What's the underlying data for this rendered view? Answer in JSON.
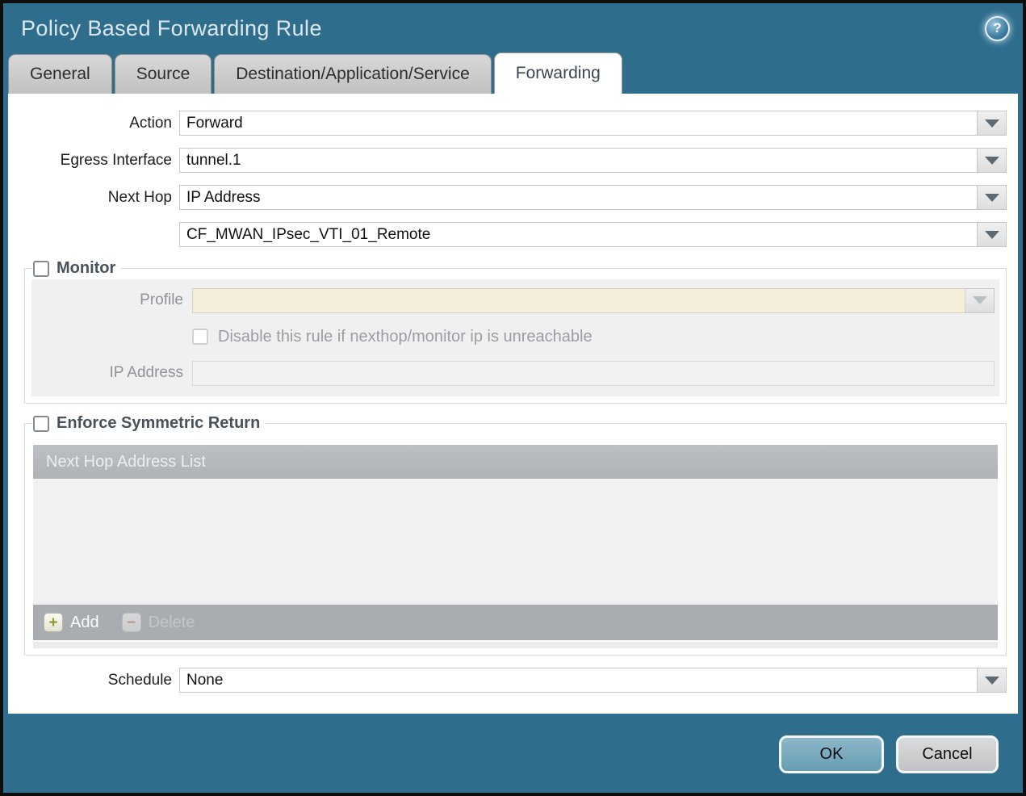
{
  "window": {
    "title": "Policy Based Forwarding Rule"
  },
  "icons": {
    "help": "?",
    "add": "+",
    "delete": "−"
  },
  "tabs": [
    {
      "label": "General",
      "active": false
    },
    {
      "label": "Source",
      "active": false
    },
    {
      "label": "Destination/Application/Service",
      "active": false
    },
    {
      "label": "Forwarding",
      "active": true
    }
  ],
  "form": {
    "action": {
      "label": "Action",
      "value": "Forward"
    },
    "egress_interface": {
      "label": "Egress Interface",
      "value": "tunnel.1"
    },
    "next_hop": {
      "label": "Next Hop",
      "value": "IP Address"
    },
    "next_hop_address": {
      "value": "CF_MWAN_IPsec_VTI_01_Remote"
    },
    "schedule": {
      "label": "Schedule",
      "value": "None"
    }
  },
  "monitor": {
    "legend": "Monitor",
    "checked": false,
    "profile": {
      "label": "Profile",
      "value": ""
    },
    "disable_rule_checkbox": {
      "label": "Disable this rule if nexthop/monitor ip is unreachable",
      "checked": false
    },
    "ip_address": {
      "label": "IP Address",
      "value": ""
    }
  },
  "symmetric_return": {
    "legend": "Enforce Symmetric Return",
    "checked": false,
    "table": {
      "header": "Next Hop Address List",
      "rows": []
    },
    "add_label": "Add",
    "delete_label": "Delete"
  },
  "footer": {
    "ok_label": "OK",
    "cancel_label": "Cancel"
  },
  "colors": {
    "titlebar_teal": "#2f6d8d",
    "ok_button": "#74a7bc",
    "cancel_button": "#c9cbcc",
    "profile_field_beige": "#f5eeda",
    "table_header_gray": "#b5b9bd",
    "legend_text": "#47525d",
    "add_plus_green": "#8d9c27",
    "delete_minus_red": "#c97f7f"
  }
}
